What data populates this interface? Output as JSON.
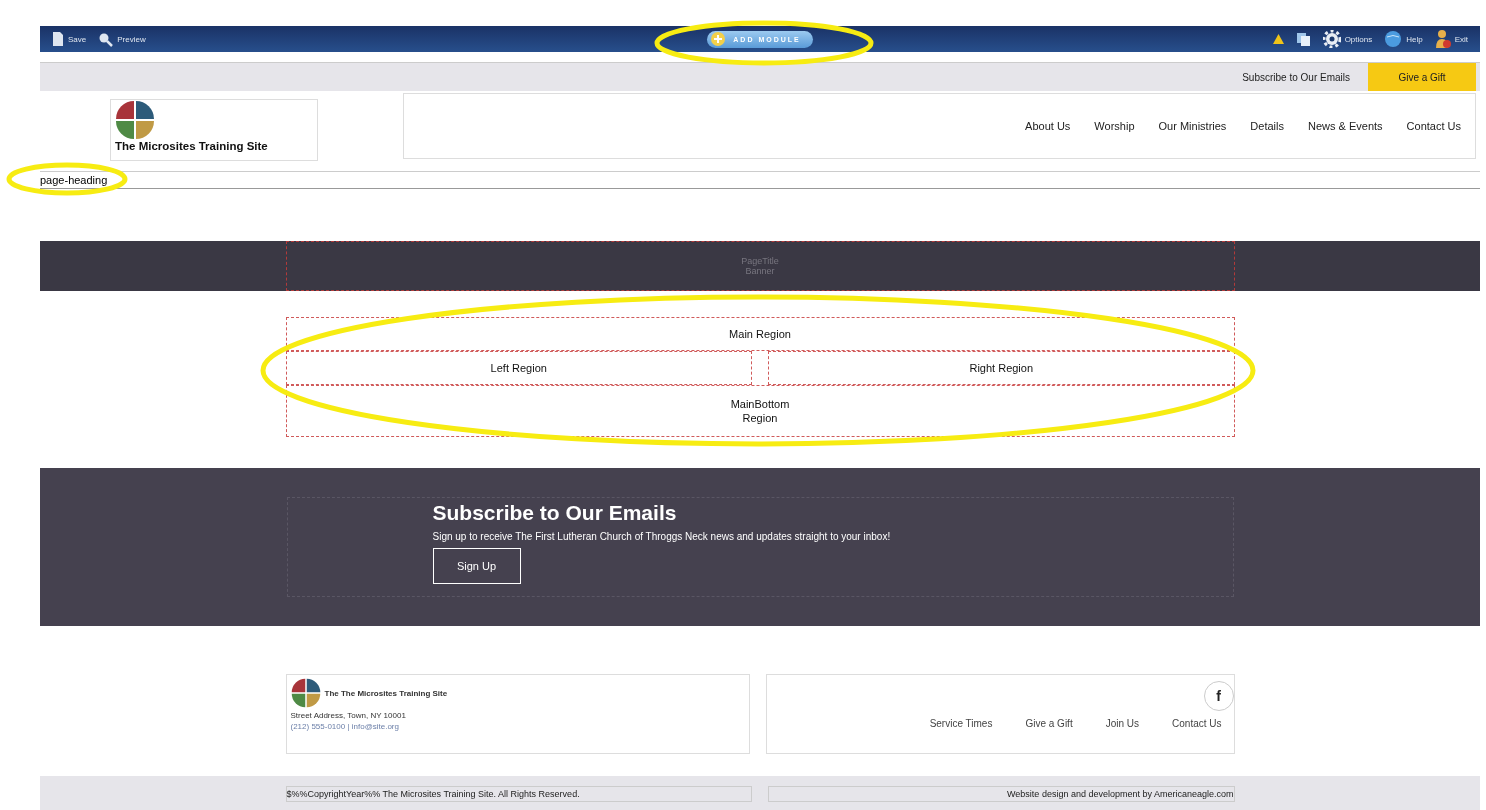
{
  "cms_toolbar": {
    "left_items": [
      {
        "kind": "save",
        "label": "Save"
      },
      {
        "kind": "preview",
        "label": "Preview"
      }
    ],
    "add_button": "ADD MODULE",
    "right_items": [
      {
        "kind": "warning"
      },
      {
        "kind": "pages"
      },
      {
        "kind": "options",
        "label": "Options"
      },
      {
        "kind": "help",
        "label": "Help"
      },
      {
        "kind": "exit",
        "label": "Exit"
      }
    ]
  },
  "utility_bar": {
    "link": "Subscribe to Our Emails",
    "button": "Give a Gift"
  },
  "header": {
    "site_name": "The Microsites Training Site",
    "nav": [
      "About Us",
      "Worship",
      "Our Ministries",
      "Details",
      "News & Events",
      "Contact Us"
    ]
  },
  "page_heading": "page-heading",
  "banner": {
    "lines": [
      "PageTitle",
      "Banner"
    ]
  },
  "regions": {
    "main": "Main Region",
    "left": "Left Region",
    "right": "Right Region",
    "bottom": [
      "MainBottom",
      "Region"
    ]
  },
  "subscribe": {
    "title": "Subscribe to Our Emails",
    "text": "Sign up to receive The First Lutheran Church of Throggs Neck news and updates straight to your inbox!",
    "button": "Sign Up"
  },
  "footer": {
    "site_name": "The The Microsites Training Site",
    "address": "Street Address, Town, NY 10001",
    "contact": "(212) 555-0100 | info@site.org",
    "social": "f",
    "links": [
      "Service Times",
      "Give a Gift",
      "Join Us",
      "Contact Us"
    ]
  },
  "copyright": {
    "left": "$%%CopyrightYear%% The Microsites Training Site. All Rights Reserved.",
    "right": "Website design and development by Americaneagle.com"
  },
  "annotations": [
    {
      "kind": "ellipse"
    },
    {
      "kind": "ellipse"
    },
    {
      "kind": "ellipse"
    }
  ]
}
